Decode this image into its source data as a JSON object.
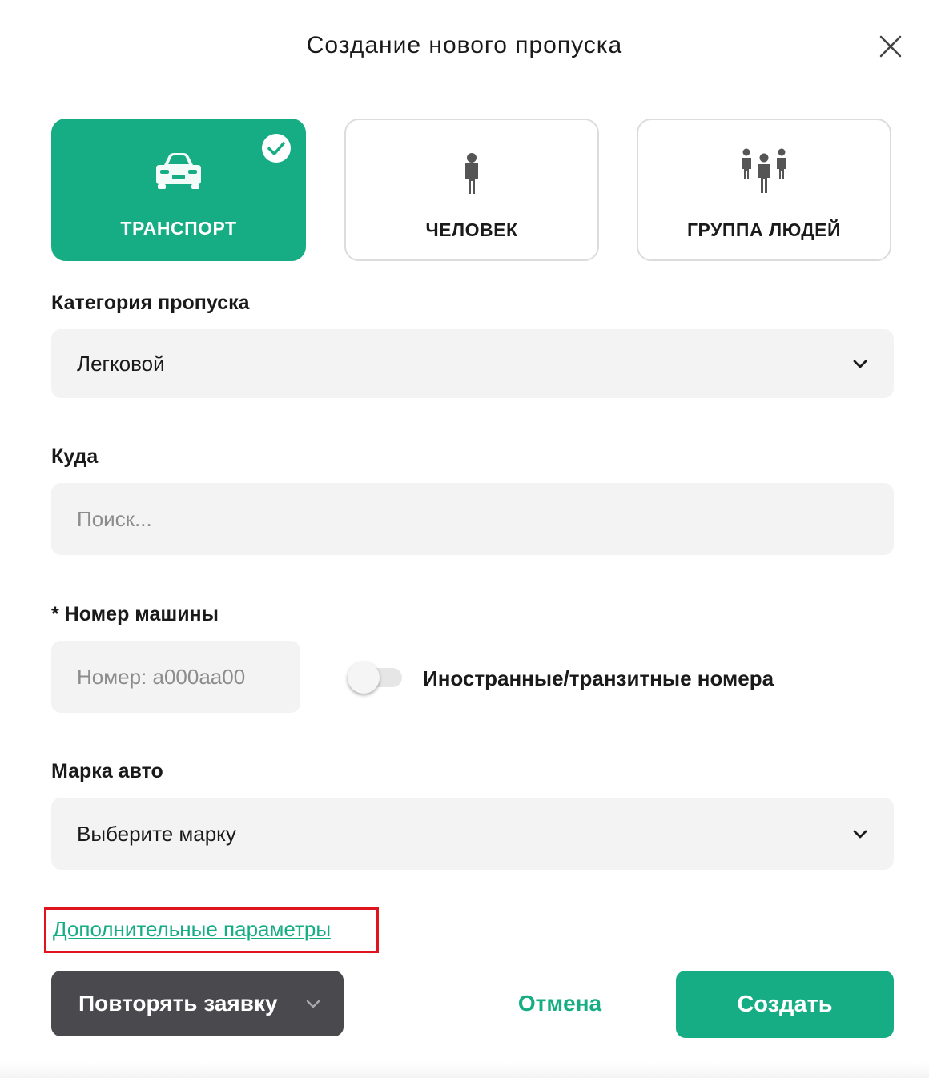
{
  "dialog": {
    "title": "Создание нового пропуска",
    "close_icon": "close-icon"
  },
  "pass_types": [
    {
      "label": "ТРАНСПОРТ",
      "icon": "car-icon",
      "selected": true
    },
    {
      "label": "ЧЕЛОВЕК",
      "icon": "person-icon",
      "selected": false
    },
    {
      "label": "ГРУППА ЛЮДЕЙ",
      "icon": "group-icon",
      "selected": false
    }
  ],
  "category": {
    "label": "Категория пропуска",
    "value": "Легковой"
  },
  "destination": {
    "label": "Куда",
    "placeholder": "Поиск..."
  },
  "car_number": {
    "label": "* Номер машины",
    "placeholder": "Номер: а000аа00",
    "foreign_toggle_label": "Иностранные/транзитные номера",
    "foreign_toggle_on": false
  },
  "car_brand": {
    "label": "Марка авто",
    "placeholder": "Выберите марку"
  },
  "extra_params_link": "Дополнительные параметры",
  "actions": {
    "repeat_label": "Повторять заявку",
    "cancel_label": "Отмена",
    "create_label": "Создать"
  },
  "colors": {
    "accent": "#17ad84",
    "dark_button": "#4a494e",
    "field_bg": "#f3f3f3",
    "highlight": "#e0141c"
  }
}
